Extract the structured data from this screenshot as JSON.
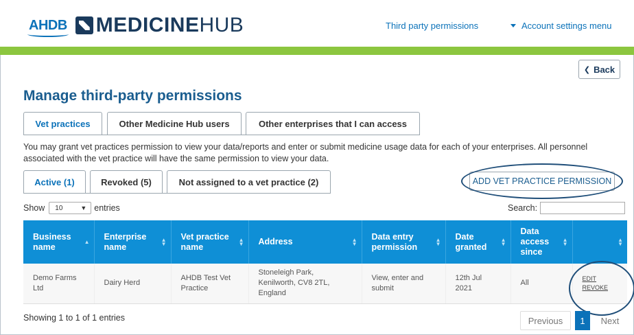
{
  "header": {
    "logo_ahdb": "AHDB",
    "logo_medicine": "MEDICINE",
    "logo_hub": "HUB",
    "nav_third_party": "Third party permissions",
    "nav_account": "Account settings menu"
  },
  "back_label": "Back",
  "page_title": "Manage third-party permissions",
  "main_tabs": [
    "Vet practices",
    "Other Medicine Hub users",
    "Other enterprises that I can access"
  ],
  "intro": "You may grant vet practices permission to view your data/reports and enter or submit medicine usage data for each of your enterprises. All personnel associated with the vet practice will have the same permission to view your data.",
  "status_tabs": [
    "Active (1)",
    "Revoked (5)",
    "Not assigned to a vet practice (2)"
  ],
  "add_button": "ADD VET PRACTICE PERMISSION",
  "length": {
    "show": "Show",
    "value": "10",
    "entries": "entries"
  },
  "search_label": "Search:",
  "table": {
    "columns": [
      "Business name",
      "Enterprise name",
      "Vet practice name",
      "Address",
      "Data entry permission",
      "Date granted",
      "Data access since",
      ""
    ],
    "rows": [
      {
        "business": "Demo Farms Ltd",
        "enterprise": "Dairy Herd",
        "vet": "AHDB Test Vet Practice",
        "address": "Stoneleigh Park, Kenilworth, CV8 2TL, England",
        "permission": "View, enter and submit",
        "date": "12th Jul 2021",
        "since": "All",
        "edit": "EDIT",
        "revoke": "REVOKE"
      }
    ]
  },
  "info": "Showing 1 to 1 of 1 entries",
  "pagination": {
    "previous": "Previous",
    "page": "1",
    "next": "Next"
  },
  "colors": {
    "brand_blue": "#0b72b9",
    "header_green": "#8cc63f",
    "table_header": "#0f8fd6",
    "annotation": "#1f4e79"
  }
}
